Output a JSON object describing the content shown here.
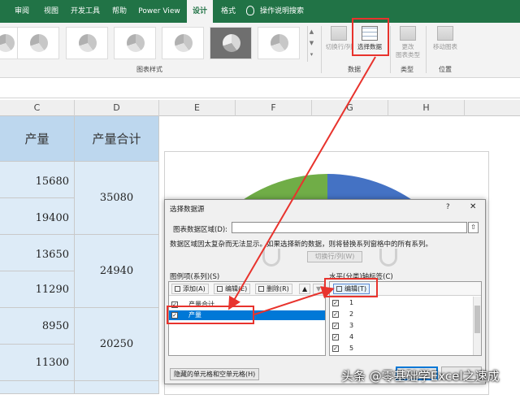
{
  "ribbon_tabs": [
    "审阅",
    "视图",
    "开发工具",
    "帮助",
    "Power View",
    "设计",
    "格式"
  ],
  "active_tab": "设计",
  "tell_me": "操作说明搜索",
  "ribbon": {
    "chart_styles_label": "图表样式",
    "data_group_label": "数据",
    "type_group_label": "类型",
    "location_group_label": "位置",
    "switch_row_col": "切换行/列",
    "select_data": "选择数据",
    "change_chart_type": [
      "更改",
      "图表类型"
    ],
    "move_chart": "移动图表"
  },
  "columns": [
    "C",
    "D",
    "E",
    "F",
    "G",
    "H"
  ],
  "sheet": {
    "header_c": "产量",
    "header_d": "产量合计",
    "c_values": [
      "15680",
      "19400",
      "13650",
      "11290",
      "8950",
      "11300"
    ],
    "d_values": [
      "35080",
      "24940",
      "20250"
    ]
  },
  "chart": {
    "colors": {
      "green": "#70ad47",
      "blue": "#4472c4"
    }
  },
  "dialog": {
    "title": "选择数据源",
    "help": "?",
    "close": "✕",
    "range_label": "图表数据区域(D):",
    "range_btn": "⇧",
    "note": "数据区域因太复杂而无法显示。如果选择新的数据，则将替换系列窗格中的所有系列。",
    "switch_btn": "切换行/列(W)",
    "series_label": "图例项(系列)(S)",
    "axis_label": "水平(分类)轴标签(C)",
    "add": "添加(A)",
    "edit": "编辑(E)",
    "remove": "删除(R)",
    "up": "▲",
    "down": "▼",
    "edit_axis": "编辑(T)",
    "series": [
      {
        "name": "产量合计",
        "checked": true,
        "selected": false
      },
      {
        "name": "产量",
        "checked": true,
        "selected": true
      }
    ],
    "axis_items": [
      "1",
      "2",
      "3",
      "4",
      "5"
    ],
    "hidden_cells": "隐藏的单元格和空单元格(H)",
    "check_mark": "✓"
  },
  "accent_red": "#e8332d",
  "watermark": "头条 @零基础学Excel之速成"
}
